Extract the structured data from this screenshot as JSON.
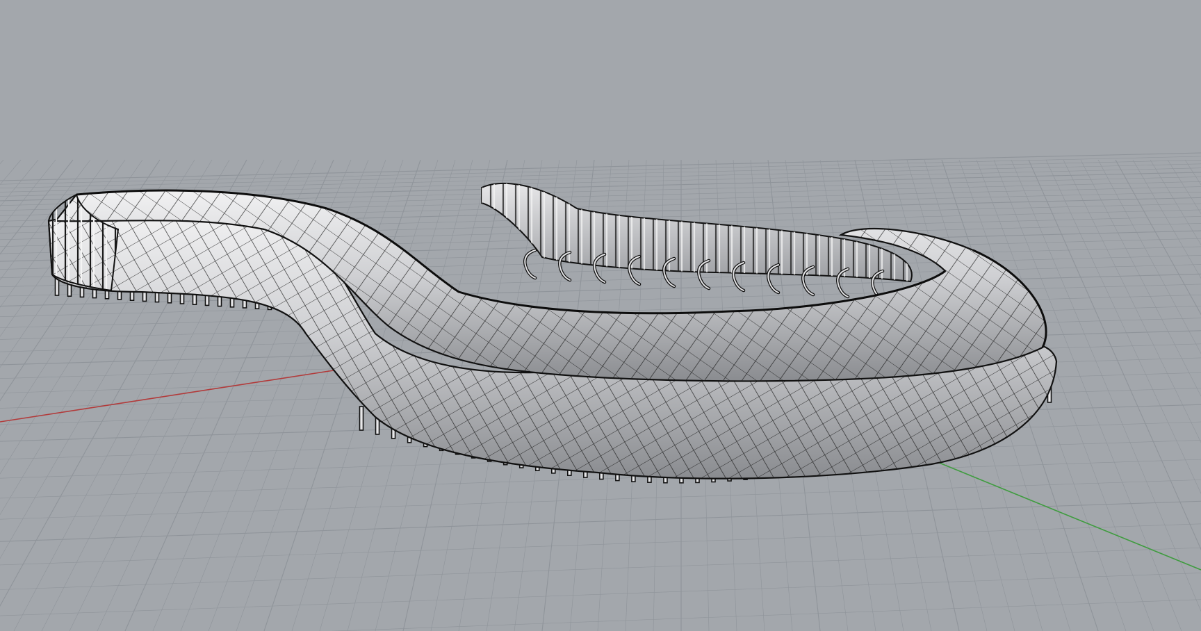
{
  "viewport": {
    "view_name": "perspective",
    "shading_mode": "shaded",
    "background_color": "#a3a7ac",
    "grid_color": "#8f949a",
    "axis_x_color": "#b23a3a",
    "axis_y_color": "#3f9c3f",
    "model_color": "#d7d7d9",
    "model_edge_color": "#111111"
  }
}
